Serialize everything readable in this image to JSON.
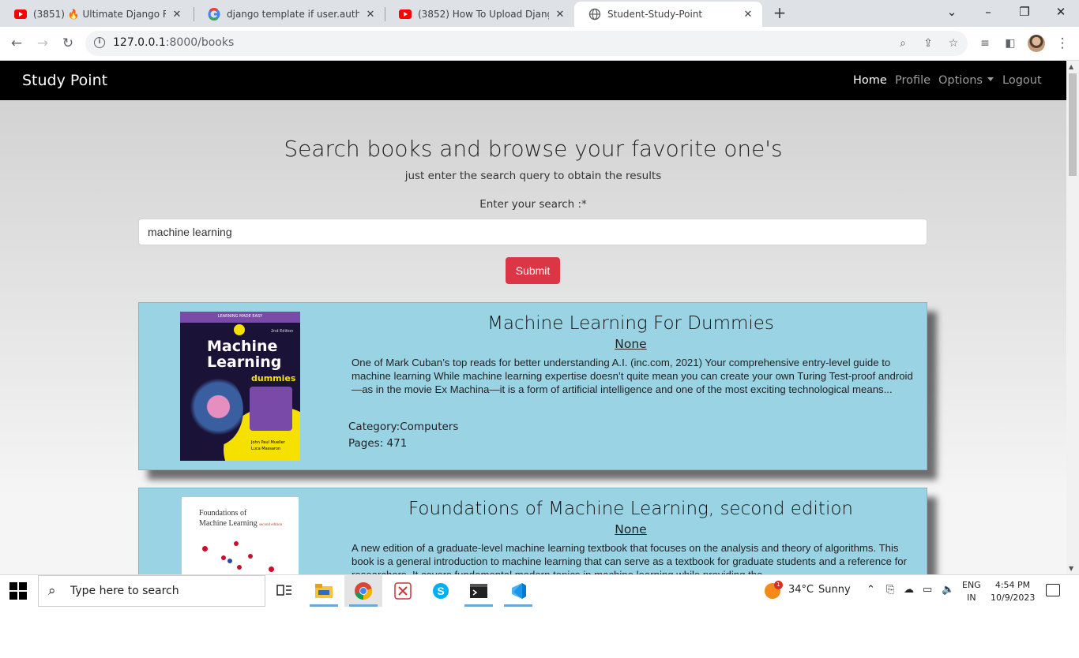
{
  "browser": {
    "tabs": [
      {
        "title": "(3851) 🔥 Ultimate Django Rest",
        "icon": "youtube-icon"
      },
      {
        "title": "django template if user.authenti",
        "icon": "google-icon"
      },
      {
        "title": "(3852) How To Upload Django W",
        "icon": "youtube-icon"
      },
      {
        "title": "Student-Study-Point",
        "icon": "globe-icon"
      }
    ],
    "url_host": "127.0.0.1",
    "url_path": ":8000/books"
  },
  "navbar": {
    "brand": "Study Point",
    "links": {
      "home": "Home",
      "profile": "Profile",
      "options": "Options",
      "logout": "Logout"
    }
  },
  "hero": {
    "title": "Search books and browse your favorite one's",
    "subtitle": "just enter the search query to obtain the results"
  },
  "search": {
    "label": "Enter your search :*",
    "value": "machine learning",
    "submit_label": "Submit"
  },
  "books": [
    {
      "title": "Machine Learning For Dummies",
      "author": "None",
      "description": "One of Mark Cuban’s top reads for better understanding A.I. (inc.com, 2021) Your comprehensive entry-level guide to machine learning While machine learning expertise doesn’t quite mean you can create your own Turing Test-proof android—as in the movie Ex Machina—it is a form of artificial intelligence and one of the most exciting technological means...",
      "category": "Category:Computers",
      "pages": "Pages: 471",
      "cover": {
        "band": "LEARNING MADE EASY",
        "edition": "2nd Edition",
        "title_line1": "Machine",
        "title_line2": "Learning",
        "brand": "dummies",
        "authors_line1": "John Paul Mueller",
        "authors_line2": "Luca Massaron"
      }
    },
    {
      "title": "Foundations of Machine Learning, second edition",
      "author": "None",
      "description": "A new edition of a graduate-level machine learning textbook that focuses on the analysis and theory of algorithms. This book is a general introduction to machine learning that can serve as a textbook for graduate students and a reference for researchers. It covers fundamental modern topics in machine learning while providing the",
      "cover": {
        "title_line1": "Foundations of",
        "title_line2": "Machine Learning",
        "edition": "second edition"
      }
    }
  ],
  "taskbar": {
    "search_placeholder": "Type here to search",
    "weather_temp": "34°C",
    "weather_desc": "Sunny",
    "weather_badge": "1",
    "lang_line1": "ENG",
    "lang_line2": "IN",
    "time": "4:54 PM",
    "date": "10/9/2023"
  },
  "colors": {
    "navbar_bg": "#000000",
    "card_bg": "#9ad4e4",
    "submit_btn": "#dc3545"
  }
}
